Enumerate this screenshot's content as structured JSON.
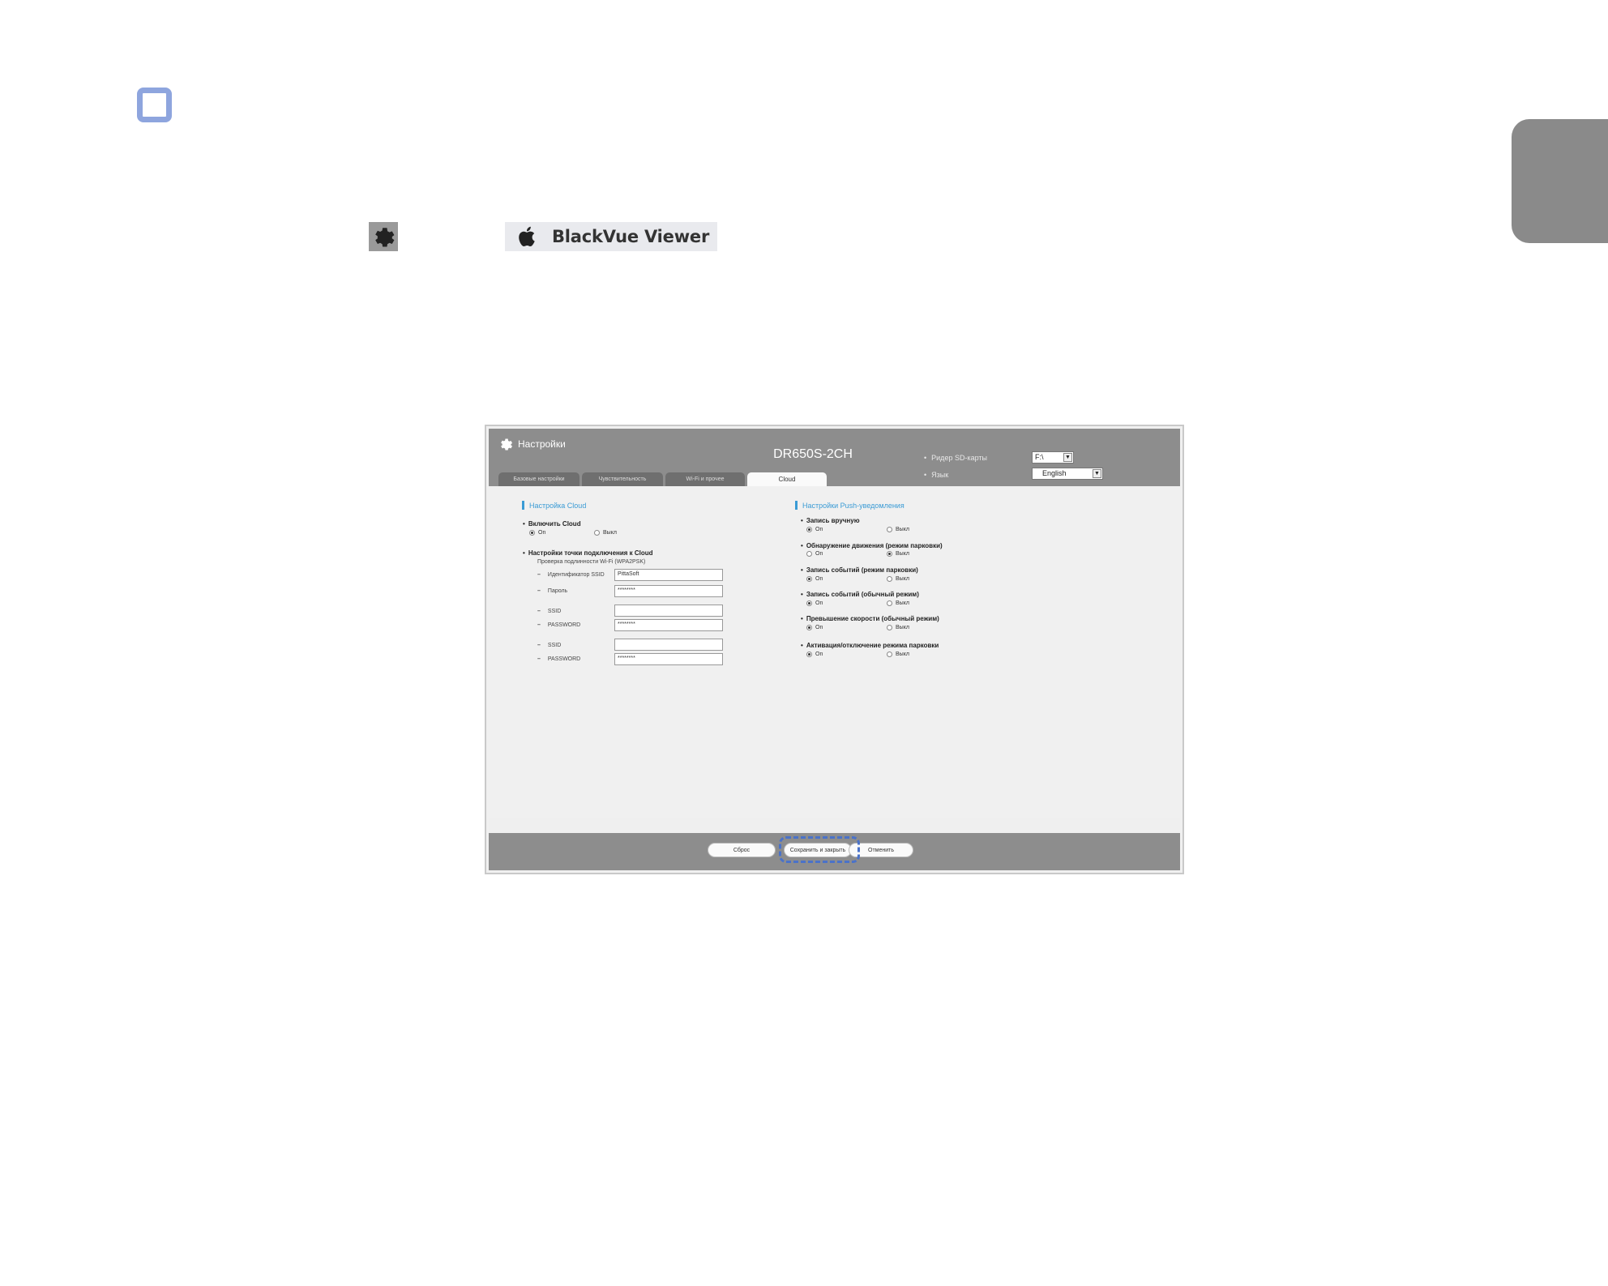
{
  "page": {
    "badge_text": "BlackVue Viewer"
  },
  "window": {
    "title": "Настройки",
    "model": "DR650S-2CH",
    "sd_reader_label": "Ридер SD-карты",
    "sd_reader_value": "F:\\",
    "language_label": "Язык",
    "language_value": "English",
    "tabs": [
      {
        "label": "Базовые настройки",
        "active": false
      },
      {
        "label": "Чувствительность",
        "active": false
      },
      {
        "label": "Wi-Fi и прочее",
        "active": false
      },
      {
        "label": "Cloud",
        "active": true
      }
    ]
  },
  "cloud": {
    "header": "Настройка Cloud",
    "enable_label": "Включить Cloud",
    "enable_on": "On",
    "enable_off": "Выкл",
    "ap_label": "Настройки точки подключения к Cloud",
    "auth_note": "Проверка подлинности Wi-Fi (WPA2PSK)",
    "fields": [
      {
        "label": "Идентификатор SSID",
        "value": "PittaSoft"
      },
      {
        "label": "Пароль",
        "value": "********"
      },
      {
        "label": "SSID",
        "value": ""
      },
      {
        "label": "PASSWORD",
        "value": "********"
      },
      {
        "label": "SSID",
        "value": ""
      },
      {
        "label": "PASSWORD",
        "value": "********"
      }
    ]
  },
  "push": {
    "header": "Настройки Push-уведомления",
    "on_label": "On",
    "off_label": "Выкл",
    "items": [
      {
        "label": "Запись вручную",
        "on": true
      },
      {
        "label": "Обнаружение движения (режим парковки)",
        "on": false
      },
      {
        "label": "Запись событий (режим парковки)",
        "on": true
      },
      {
        "label": "Запись событий (обычный режим)",
        "on": true
      },
      {
        "label": "Превышение скорости (обычный режим)",
        "on": true
      },
      {
        "label": "Активация/отключение режима парковки",
        "on": true
      }
    ]
  },
  "footer": {
    "reset": "Сброс",
    "save_close": "Сохранить и закрыть",
    "cancel": "Отменить"
  },
  "colors": {
    "accent_blue": "#3a9bd5",
    "highlight": "#4a72c9",
    "header_gray": "#8d8d8d"
  }
}
